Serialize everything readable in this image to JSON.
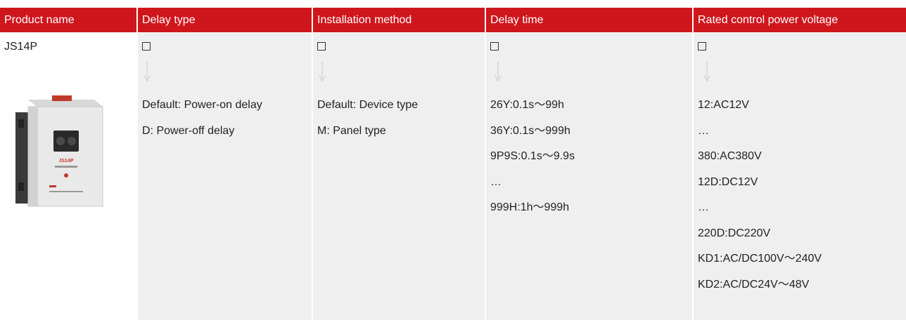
{
  "headers": [
    {
      "label": "Product name"
    },
    {
      "label": "Delay type"
    },
    {
      "label": "Installation method"
    },
    {
      "label": "Delay time"
    },
    {
      "label": "Rated control power voltage"
    }
  ],
  "code_row": {
    "product": "JS14P",
    "placeholder_glyph": "☐"
  },
  "columns": {
    "delay_type": [
      "Default: Power-on delay",
      "D: Power-off delay"
    ],
    "installation": [
      "Default: Device type",
      "M: Panel type"
    ],
    "delay_time": [
      "26Y:0.1s～99h",
      "36Y:0.1s～999h",
      "9P9S:0.1s～9.9s",
      "…",
      "999H:1h～999h"
    ],
    "voltage": [
      "12:AC12V",
      "…",
      "380:AC380V",
      "12D:DC12V",
      "…",
      "220D:DC220V",
      "KD1:AC/DC100V～240V",
      "KD2:AC/DC24V～48V"
    ]
  },
  "product_image": {
    "model_label": "JS14P",
    "icon": "time-relay-image"
  },
  "colors": {
    "header_bg": "#d0161d",
    "header_text": "#ffffff",
    "cell_bg": "#efefef",
    "arrow": "#c8c8c8"
  }
}
